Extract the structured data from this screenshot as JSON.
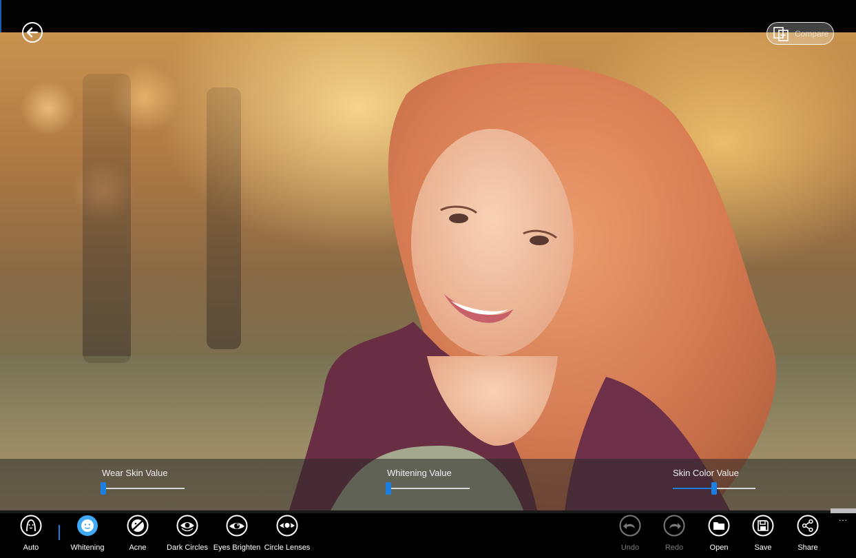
{
  "header": {
    "back_icon": "back-arrow-icon",
    "compare_label": "Compare",
    "compare_icon": "compare-icon"
  },
  "sliders": [
    {
      "label": "Wear Skin Value",
      "value": 0.02
    },
    {
      "label": "Whitening Value",
      "value": 0.02
    },
    {
      "label": "Skin Color Value",
      "value": 0.5
    }
  ],
  "tools_left": [
    {
      "label": "Auto",
      "icon": "auto-face-icon",
      "selected": false
    },
    {
      "label": "Whitening",
      "icon": "whitening-face-icon",
      "selected": true
    },
    {
      "label": "Acne",
      "icon": "acne-icon",
      "selected": false
    },
    {
      "label": "Dark Circles",
      "icon": "dark-circles-eye-icon",
      "selected": false
    },
    {
      "label": "Eyes Brighten",
      "icon": "eyes-brighten-icon",
      "selected": false
    },
    {
      "label": "Circle Lenses",
      "icon": "circle-lenses-icon",
      "selected": false
    }
  ],
  "tools_right": [
    {
      "label": "Undo",
      "icon": "undo-icon",
      "enabled": false
    },
    {
      "label": "Redo",
      "icon": "redo-icon",
      "enabled": false
    },
    {
      "label": "Open",
      "icon": "folder-open-icon",
      "enabled": true
    },
    {
      "label": "Save",
      "icon": "save-disk-icon",
      "enabled": true
    },
    {
      "label": "Share",
      "icon": "share-icon",
      "enabled": true
    }
  ],
  "more_label": "...",
  "colors": {
    "accent": "#1a7fe0",
    "background": "#000000"
  }
}
